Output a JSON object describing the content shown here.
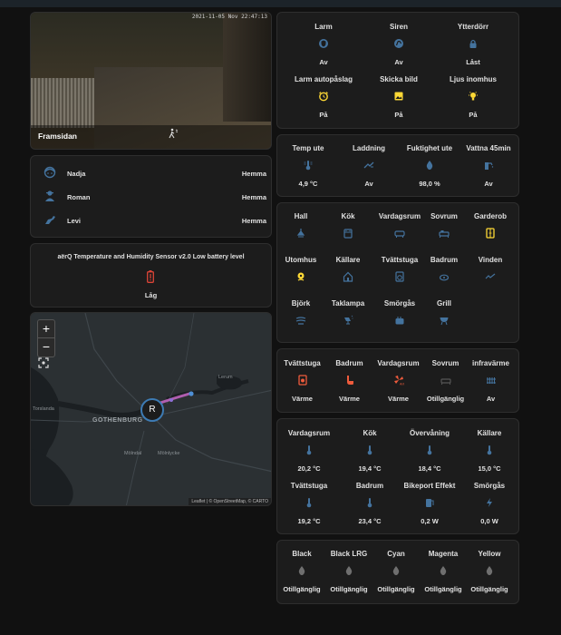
{
  "camera": {
    "title": "Framsidan",
    "timestamp": "2021-11-05 Nov 22:47:13"
  },
  "persons": [
    {
      "name": "Nadja",
      "state": "Hemma",
      "icon": "face-icon"
    },
    {
      "name": "Roman",
      "state": "Hemma",
      "icon": "person-icon"
    },
    {
      "name": "Levi",
      "state": "Hemma",
      "icon": "dog-icon"
    }
  ],
  "battery": {
    "title": "aërQ Temperature and Humidity Sensor v2.0 Low battery level",
    "state": "Låg",
    "color": "#db4437"
  },
  "map": {
    "city_label": "GOTHENBURG",
    "place_labels": [
      "Lerum",
      "Mölndal",
      "Mölnlycke",
      "Torslanda"
    ],
    "marker_letter": "R",
    "zoom_in": "+",
    "zoom_out": "−",
    "attribution": "Leaflet | © OpenStreetMap, © CARTO"
  },
  "alarm": [
    {
      "label": "Larm",
      "state": "Av",
      "icon": "shield-icon"
    },
    {
      "label": "Siren",
      "state": "Av",
      "icon": "siren-icon"
    },
    {
      "label": "Ytterdörr",
      "state": "Låst",
      "icon": "lock-icon"
    },
    {
      "label": "Larm autopåslag",
      "state": "På",
      "icon": "alarm-clock-icon"
    },
    {
      "label": "Skicka bild",
      "state": "På",
      "icon": "image-icon"
    },
    {
      "label": "Ljus inomhus",
      "state": "På",
      "icon": "lightbulb-icon"
    }
  ],
  "outdoor": [
    {
      "label": "Temp ute",
      "state": "4,9 °C",
      "icon": "thermometer-icon"
    },
    {
      "label": "Laddning",
      "state": "Av",
      "icon": "ev-charger-icon"
    },
    {
      "label": "Fuktighet ute",
      "state": "98,0 %",
      "icon": "water-drop-icon"
    },
    {
      "label": "Vattna 45min",
      "state": "Av",
      "icon": "sprinkler-icon"
    }
  ],
  "lights": [
    {
      "label": "Hall",
      "icon": "ceiling-light-icon"
    },
    {
      "label": "Kök",
      "icon": "stove-icon"
    },
    {
      "label": "Vardagsrum",
      "icon": "sofa-icon"
    },
    {
      "label": "Sovrum",
      "icon": "bed-icon"
    },
    {
      "label": "Garderob",
      "icon": "wardrobe-icon"
    },
    {
      "label": "Utomhus",
      "icon": "flower-icon"
    },
    {
      "label": "Källare",
      "icon": "house-icon"
    },
    {
      "label": "Tvättstuga",
      "icon": "washing-machine-icon"
    },
    {
      "label": "Badrum",
      "icon": "bathtub-icon"
    },
    {
      "label": "Vinden",
      "icon": "roof-icon"
    },
    {
      "label": "Björk",
      "icon": "tree-icon"
    },
    {
      "label": "Taklampa",
      "icon": "lamp-icon"
    },
    {
      "label": "Smörgås",
      "icon": "toaster-icon"
    },
    {
      "label": "Grill",
      "icon": "grill-icon"
    }
  ],
  "heating": [
    {
      "label": "Tvättstuga",
      "state": "Värme",
      "icon": "heater-icon",
      "active": true
    },
    {
      "label": "Badrum",
      "state": "Värme",
      "icon": "heated-floor-icon",
      "active": true
    },
    {
      "label": "Vardagsrum",
      "state": "Värme",
      "icon": "heat-pump-icon",
      "active": true
    },
    {
      "label": "Sovrum",
      "state": "Otillgänglig",
      "icon": "bed-heat-icon",
      "active": false
    },
    {
      "label": "infravärme",
      "state": "Av",
      "icon": "radiator-icon",
      "active": false
    }
  ],
  "temperatures": [
    {
      "label": "Vardagsrum",
      "state": "20,2 °C",
      "icon": "thermometer-icon"
    },
    {
      "label": "Kök",
      "state": "19,4 °C",
      "icon": "thermometer-icon"
    },
    {
      "label": "Övervåning",
      "state": "18,4 °C",
      "icon": "thermometer-icon"
    },
    {
      "label": "Källare",
      "state": "15,0 °C",
      "icon": "thermometer-icon"
    },
    {
      "label": "Tvättstuga",
      "state": "19,2 °C",
      "icon": "thermometer-icon"
    },
    {
      "label": "Badrum",
      "state": "23,4 °C",
      "icon": "thermometer-icon"
    },
    {
      "label": "Bikeport Effekt",
      "state": "0,2 W",
      "icon": "power-plug-icon"
    },
    {
      "label": "Smörgås",
      "state": "0,0 W",
      "icon": "flash-icon"
    }
  ],
  "ink": [
    {
      "label": "Black",
      "state": "Otillgänglig",
      "icon": "ink-drop-icon"
    },
    {
      "label": "Black LRG",
      "state": "Otillgänglig",
      "icon": "ink-drop-icon"
    },
    {
      "label": "Cyan",
      "state": "Otillgänglig",
      "icon": "ink-drop-icon"
    },
    {
      "label": "Magenta",
      "state": "Otillgänglig",
      "icon": "ink-drop-icon"
    },
    {
      "label": "Yellow",
      "state": "Otillgänglig",
      "icon": "ink-drop-icon"
    }
  ],
  "colors": {
    "icon_blue": "#44739e",
    "icon_yellow": "#fdd835",
    "icon_red": "#ef5b3c",
    "icon_grey": "#6f6f6f",
    "card_bg": "#1c1c1c"
  }
}
